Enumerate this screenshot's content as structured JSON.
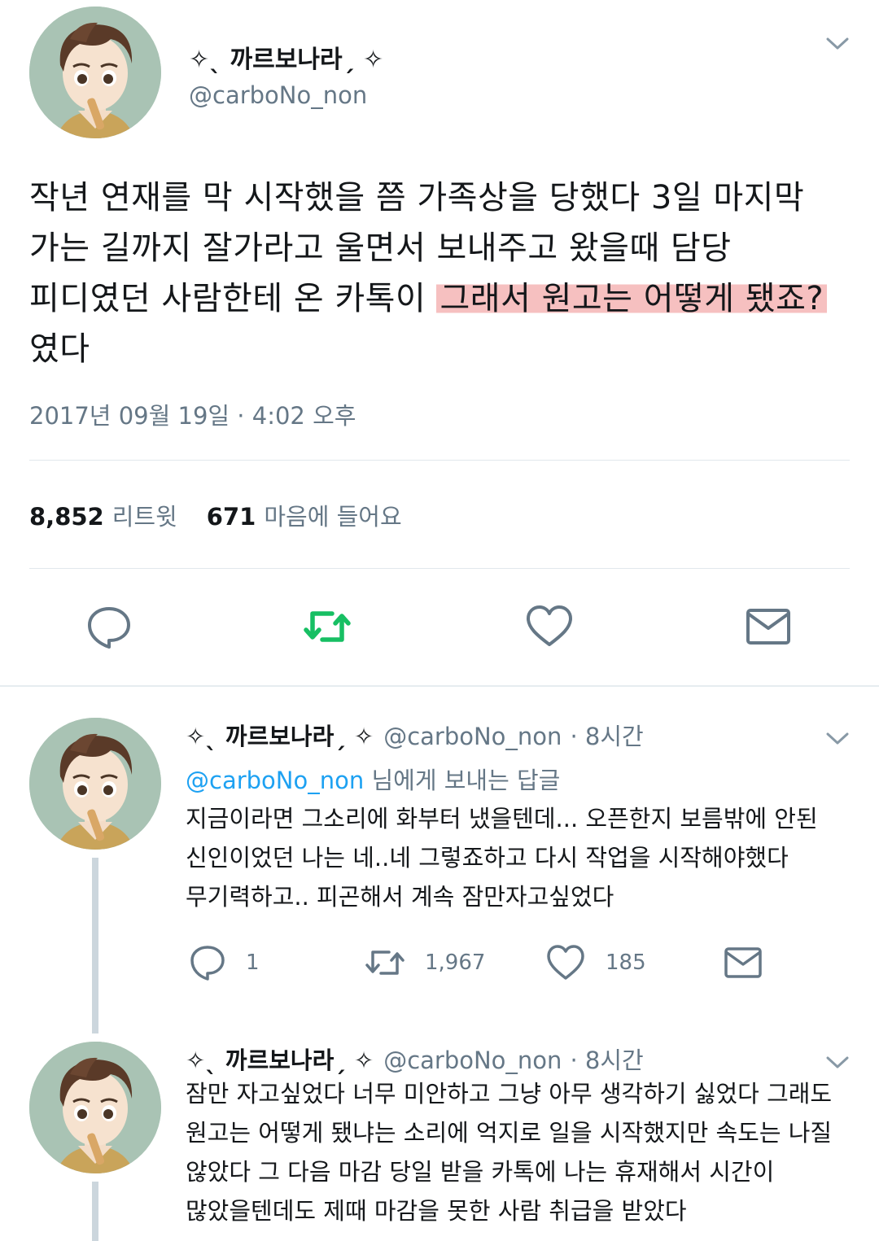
{
  "main_tweet": {
    "display_name": "✧ˎ 까르보나라ˏ ✧",
    "handle": "@carboNo_non",
    "text_lines": [
      "작년 연재를 막 시작했을 쯤 가족상을 당했다 3일 마지막",
      "가는 길까지 잘가라고 울면서 보내주고 왔을때 담당",
      "피디였던 사람한테 온 카톡이 ",
      "였다"
    ],
    "highlighted_text": "그래서 원고는 어떻게 됐죠?",
    "timestamp": "2017년 09월 19일 · 4:02 오후",
    "retweet_count": "8,852",
    "retweet_label": "리트윗",
    "like_count": "671",
    "like_label": "마음에 들어요",
    "icons": {
      "reply": "reply-bubble-icon",
      "retweet": "retweet-icon",
      "like": "heart-icon",
      "dm": "envelope-icon"
    },
    "colors": {
      "retweet_active": "#17bf63",
      "highlight": "#f09696",
      "icon_gray": "#657786"
    }
  },
  "replies": [
    {
      "display_name": "✧ˎ 까르보나라ˏ ✧",
      "handle": "@carboNo_non",
      "time": "· 8시간",
      "reply_to_mention": "@carboNo_non",
      "reply_to_suffix": " 님에게 보내는 답글",
      "text_lines": [
        "지금이라면 그소리에 화부터 냈을텐데... 오픈한지 보름밖에 안된",
        "신인이었던 나는 네..네 그렇죠하고 다시 작업을 시작해야했다",
        "무기력하고.. 피곤해서 계속 잠만자고싶었다"
      ],
      "reply_count": "1",
      "retweet_count": "1,967",
      "like_count": "185"
    },
    {
      "display_name": "✧ˎ 까르보나라ˏ ✧",
      "handle": "@carboNo_non",
      "time": "· 8시간",
      "text_lines": [
        "잠만 자고싶었다 너무 미안하고 그냥 아무 생각하기 싫었다 그래도",
        "원고는 어떻게 됐냐는 소리에 억지로 일을 시작했지만 속도는 나질",
        "않았다 그 다음 마감 당일 받을 카톡에 나는 휴재해서 시간이",
        "많았을텐데도 제때 마감을 못한 사람 취급을 받았다"
      ]
    }
  ]
}
